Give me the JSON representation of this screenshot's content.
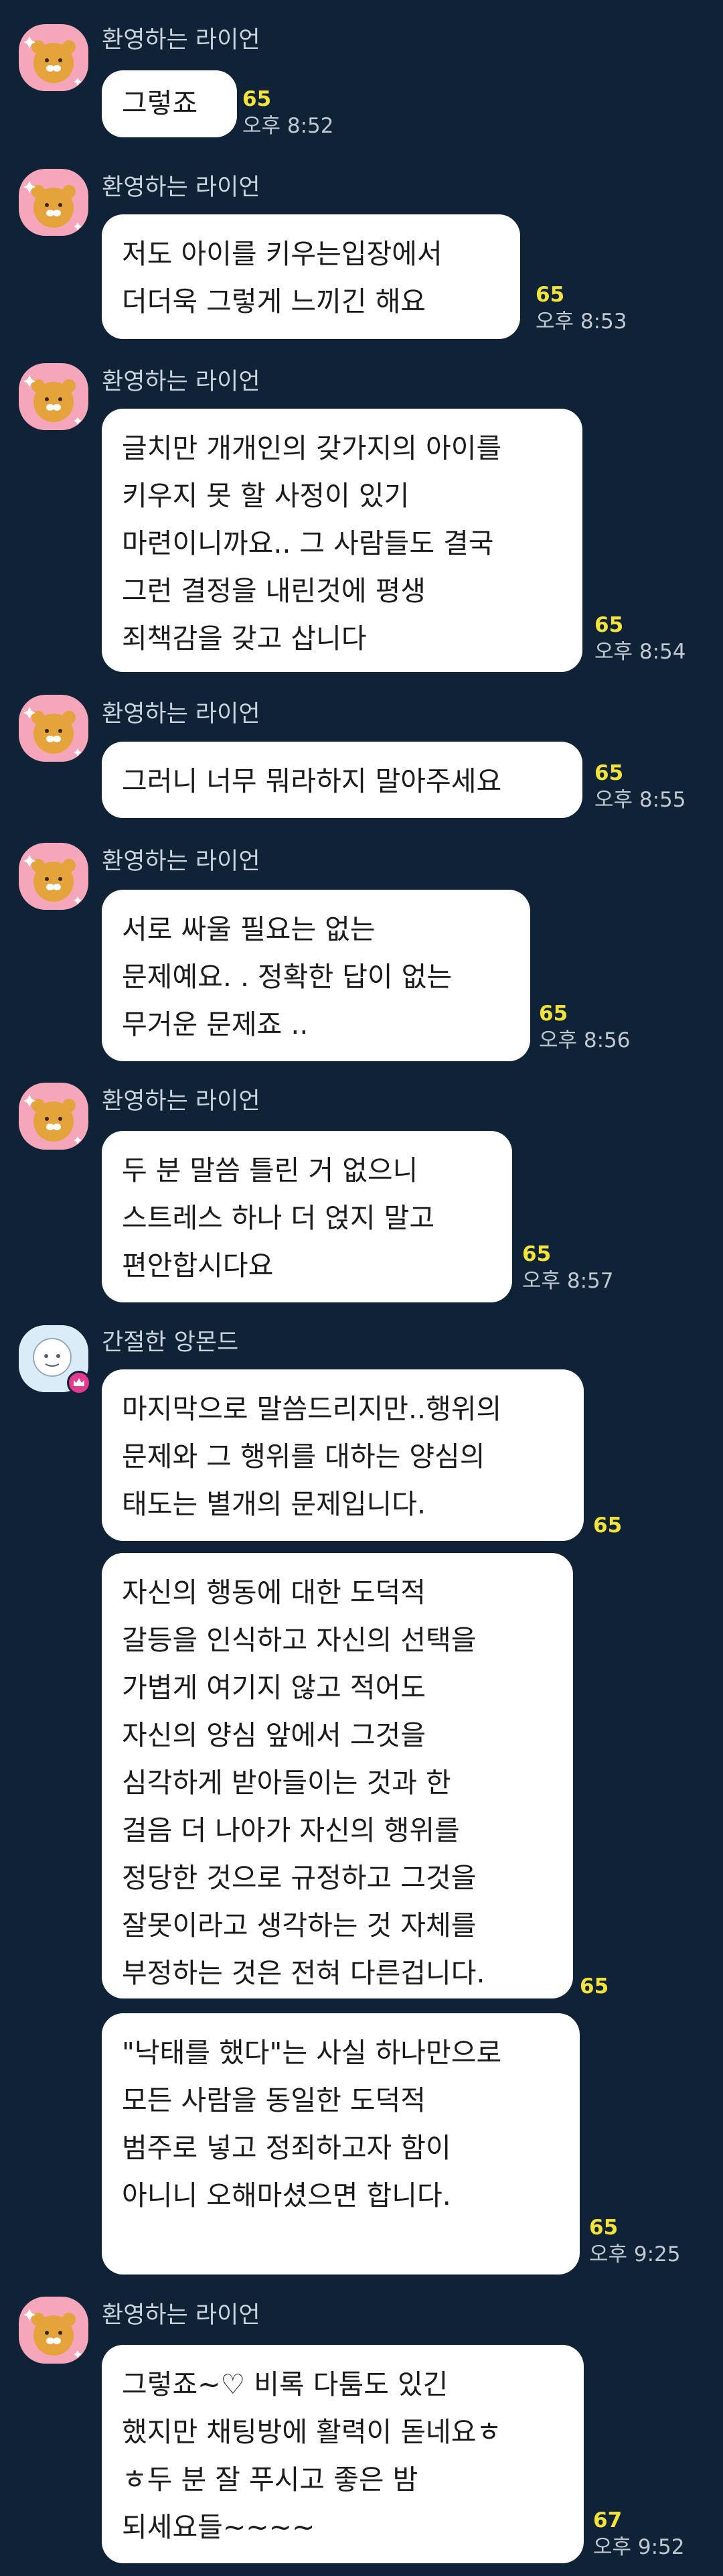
{
  "messages": [
    {
      "sender": "환영하는 라이언",
      "text": "그렇죠",
      "unread": "65",
      "time": "오후 8:52",
      "avatar": "ryan-character-avatar"
    },
    {
      "sender": "환영하는 라이언",
      "text": "저도 아이를 키우는입장에서\n더더욱 그렇게 느끼긴 해요",
      "unread": "65",
      "time": "오후 8:53",
      "avatar": "ryan-character-avatar"
    },
    {
      "sender": "환영하는 라이언",
      "text": "글치만 개개인의 갖가지의 아이를\n키우지 못 할 사정이 있기\n마련이니까요.. 그 사람들도 결국\n그런 결정을 내린것에 평생\n죄책감을 갖고 삽니다",
      "unread": "65",
      "time": "오후 8:54",
      "avatar": "ryan-character-avatar"
    },
    {
      "sender": "환영하는 라이언",
      "text": "그러니 너무 뭐라하지 말아주세요",
      "unread": "65",
      "time": "오후 8:55",
      "avatar": "ryan-character-avatar"
    },
    {
      "sender": "환영하는 라이언",
      "text": "서로 싸울 필요는 없는\n문제예요. . 정확한 답이 없는\n무거운 문제죠 ..",
      "unread": "65",
      "time": "오후 8:56",
      "avatar": "ryan-character-avatar"
    },
    {
      "sender": "환영하는 라이언",
      "text": "두 분 말씀 틀린 거 없으니\n스트레스 하나 더 얹지 말고\n편안합시다요",
      "unread": "65",
      "time": "오후 8:57",
      "avatar": "ryan-character-avatar"
    },
    {
      "sender": "간절한 앙몬드",
      "text": "마지막으로 말씀드리지만..행위의\n문제와 그 행위를 대하는 양심의\n태도는 별개의 문제입니다.",
      "unread": "65",
      "time": "",
      "avatar": "default-profile-avatar"
    },
    {
      "sender": "",
      "text": "자신의 행동에 대한 도덕적\n갈등을 인식하고  자신의 선택을\n가볍게 여기지 않고  적어도\n자신의 양심 앞에서 그것을\n심각하게 받아들이는 것과 한\n걸음 더 나아가 자신의 행위를\n정당한 것으로 규정하고 그것을\n잘못이라고 생각하는 것 자체를\n부정하는 것은 전혀 다른겁니다.",
      "unread": "65",
      "time": "",
      "avatar": ""
    },
    {
      "sender": "",
      "text": "\"낙태를 했다\"는 사실 하나만으로\n모든 사람을 동일한 도덕적\n범주로 넣고 정죄하고자 함이\n아니니 오해마셨으면 합니다.",
      "unread": "65",
      "time": "오후 9:25",
      "avatar": ""
    },
    {
      "sender": "환영하는 라이언",
      "text": "그렇죠~♡ 비록 다툼도 있긴\n했지만 채팅방에 활력이 돋네요ㅎ\nㅎ두 분 잘 푸시고 좋은 밤\n되세요들~~~~",
      "unread": "67",
      "time": "오후 9:52",
      "avatar": "ryan-character-avatar"
    }
  ],
  "colors": {
    "background": "#0f2236",
    "bubble": "#ffffff",
    "unread": "#f4e33a",
    "sender": "#c9d3dd",
    "time": "#c0c8d2"
  }
}
